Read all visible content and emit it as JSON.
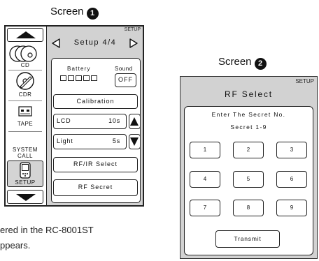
{
  "screen1": {
    "caption": "Screen",
    "caption_num": "1",
    "scroll_up_icon": "triangle-up",
    "scroll_down_icon": "triangle-down",
    "sources": [
      {
        "label": "CD",
        "icon": "cd-stack-icon"
      },
      {
        "label": "CDR",
        "icon": "cdr-disc-icon"
      },
      {
        "label": "TAPE",
        "icon": "cassette-icon"
      },
      {
        "label": "SYSTEM\nCALL",
        "icon": ""
      },
      {
        "label": "SETUP",
        "icon": "remote-icon",
        "selected": true
      }
    ],
    "setup_tag": "SETUP",
    "page_title": "Setup 4/4",
    "battery_label": "Battery",
    "battery_level": 0,
    "sound_label": "Sound",
    "sound_button": "OFF",
    "calibration_button": "Calibration",
    "lcd_label": "LCD",
    "lcd_value": "10s",
    "light_label": "Light",
    "light_value": "5s",
    "rf_ir_button": "RF/IR Select",
    "rf_secret_button": "RF Secret"
  },
  "manual_text": {
    "line1": "ered in the RC-8001ST",
    "line2": "ppears."
  },
  "screen2": {
    "caption": "Screen",
    "caption_num": "2",
    "setup_tag": "SETUP",
    "title": "RF Select",
    "prompt_line1": "Enter The Secret No.",
    "prompt_line2": "Secret 1-9",
    "keys": [
      "1",
      "2",
      "3",
      "4",
      "5",
      "6",
      "7",
      "8",
      "9"
    ],
    "transmit_button": "Transmit"
  }
}
